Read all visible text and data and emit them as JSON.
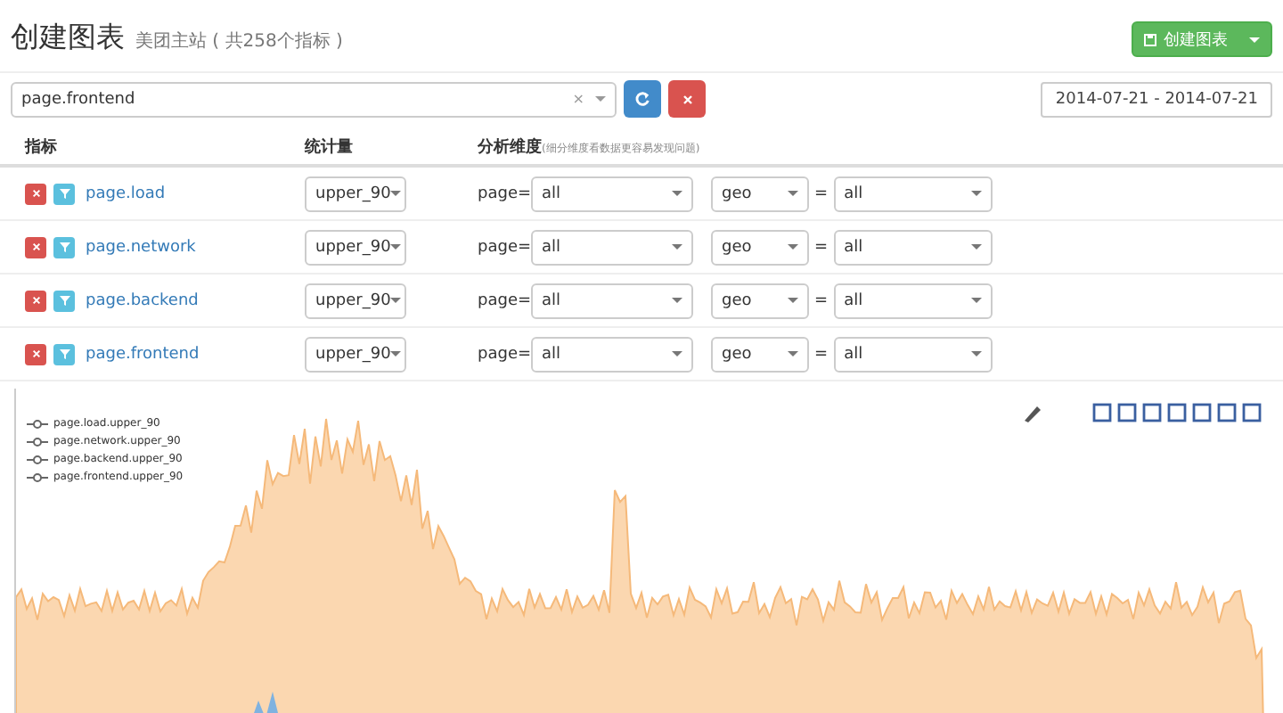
{
  "header": {
    "title": "创建图表",
    "subtitle": "美团主站 ( 共258个指标 )",
    "create_button": "创建图表"
  },
  "search": {
    "value": "page.frontend",
    "clear": "×",
    "date_range": "2014-07-21 - 2014-07-21"
  },
  "table": {
    "columns": [
      "指标",
      "统计量",
      "分析维度"
    ],
    "dimension_hint": "(细分维度看数据更容易发现问题)",
    "rows": [
      {
        "metric": "page.load",
        "stat": "upper_90",
        "dim_key": "page=",
        "dim_value": "all",
        "dim2": "geo",
        "eq": "=",
        "dim2_value": "all"
      },
      {
        "metric": "page.network",
        "stat": "upper_90",
        "dim_key": "page=",
        "dim_value": "all",
        "dim2": "geo",
        "eq": "=",
        "dim2_value": "all"
      },
      {
        "metric": "page.backend",
        "stat": "upper_90",
        "dim_key": "page=",
        "dim_value": "all",
        "dim2": "geo",
        "eq": "=",
        "dim2_value": "all"
      },
      {
        "metric": "page.frontend",
        "stat": "upper_90",
        "dim_key": "page=",
        "dim_value": "all",
        "dim2": "geo",
        "eq": "=",
        "dim2_value": "all"
      }
    ]
  },
  "chart": {
    "legend": [
      "page.load.upper_90",
      "page.network.upper_90",
      "page.backend.upper_90",
      "page.frontend.upper_90"
    ]
  }
}
